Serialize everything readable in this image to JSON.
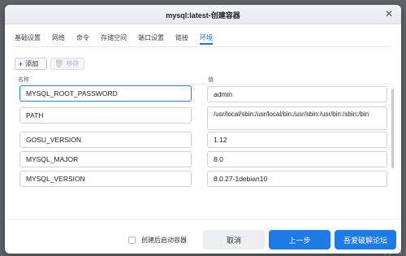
{
  "dialog": {
    "title": "mysql:latest-创建容器",
    "close_icon": "✕"
  },
  "tabs": [
    {
      "label": "基础设置"
    },
    {
      "label": "网络"
    },
    {
      "label": "命令"
    },
    {
      "label": "存储空间"
    },
    {
      "label": "端口设置"
    },
    {
      "label": "链接"
    },
    {
      "label": "环境"
    }
  ],
  "active_tab": "环境",
  "toolbar": {
    "add_icon": "+",
    "add_label": "添加",
    "delete_icon": "🗑",
    "delete_label": "移除"
  },
  "table": {
    "col_name": "名称",
    "col_value": "值",
    "rows": [
      {
        "name": "MYSQL_ROOT_PASSWORD",
        "value": "admin"
      },
      {
        "name": "PATH",
        "value": "/usr/local/sbin:/usr/local/bin:/usr/sbin:/usr/bin:/sbin:/bin"
      },
      {
        "name": "GOSU_VERSION",
        "value": "1.12"
      },
      {
        "name": "MYSQL_MAJOR",
        "value": "8.0"
      },
      {
        "name": "MYSQL_VERSION",
        "value": "8.0.27-1debian10"
      }
    ]
  },
  "footer": {
    "start_after_create_label": "创建后启动容器",
    "cancel_label": "取消",
    "previous_label": "上一步",
    "next_label": "吾爱破解论坛"
  },
  "watermark": {
    "url": "www.52pojie.cn"
  },
  "colors": {
    "accent": "#1e7be6",
    "focus_border": "#2b7de9"
  }
}
